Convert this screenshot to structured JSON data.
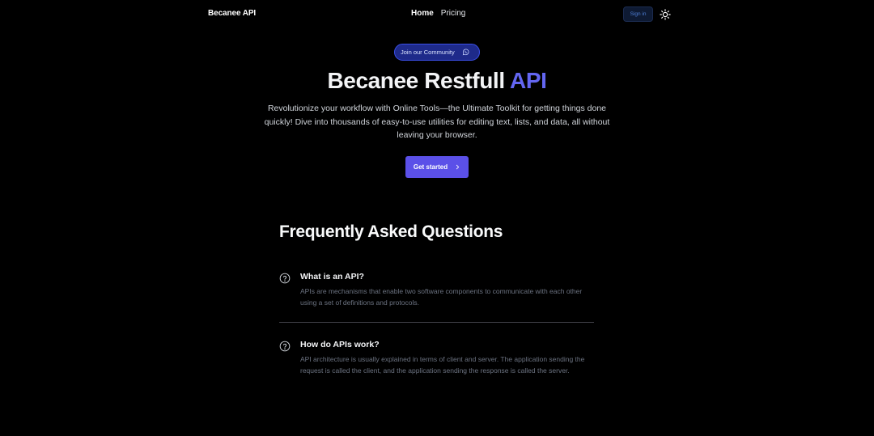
{
  "nav": {
    "brand": "Becanee API",
    "links": [
      "Home",
      "Pricing"
    ],
    "signin_label": "Sign in",
    "theme_icon": "sun-icon"
  },
  "hero": {
    "community_label": "Join our Community",
    "community_icon": "whatsapp-icon",
    "title_main": "Becanee Restfull",
    "title_accent": "API",
    "description": "Revolutionize your workflow with Online Tools—the Ultimate Toolkit for getting things done quickly! Dive into thousands of easy-to-use utilities for editing text, lists, and data, all without leaving your browser.",
    "cta_label": "Get started",
    "cta_icon": "chevron-right-icon"
  },
  "faq": {
    "title": "Frequently Asked Questions",
    "items": [
      {
        "question": "What is an API?",
        "answer": "APIs are mechanisms that enable two software components to communicate with each other using a set of definitions and protocols."
      },
      {
        "question": "How do APIs work?",
        "answer": "API architecture is usually explained in terms of client and server. The application sending the request is called the client, and the application sending the response is called the server."
      }
    ]
  },
  "colors": {
    "background": "#000000",
    "accent": "#6366f1",
    "cta": "#5b50e8",
    "community_border": "#3b4fe8"
  }
}
